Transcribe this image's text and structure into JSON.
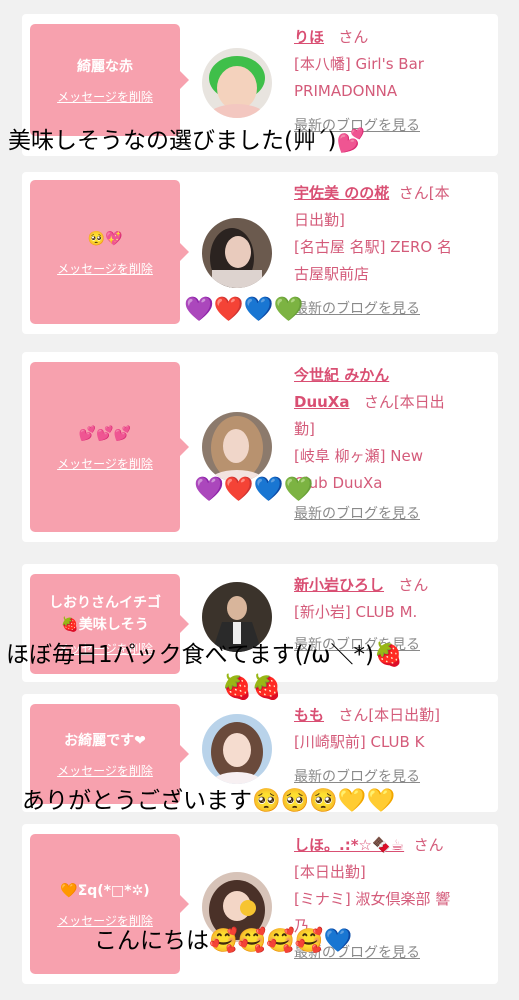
{
  "cards": [
    {
      "message": "綺麗な赤",
      "delete_label": "メッセージを削除",
      "name": "りほ",
      "honorific": "さん",
      "shop_lines": [
        "[本八幡] Girl's Bar",
        "PRIMADONNA"
      ],
      "blog_label": "最新のブログを見る"
    },
    {
      "message": "🥺💖",
      "delete_label": "メッセージを削除",
      "name_lines": [
        "宇佐美 のの椛"
      ],
      "honorific": "さん[本",
      "shop_lines": [
        "日出勤]",
        "[名古屋 名駅] ZERO 名",
        "古屋駅前店"
      ],
      "blog_label": "最新のブログを見る"
    },
    {
      "message": "💕💕💕",
      "delete_label": "メッセージを削除",
      "name_lines": [
        "今世紀 みかん",
        "DuuXa"
      ],
      "honorific": "さん[本日出",
      "shop_lines": [
        "勤]",
        "[岐阜 柳ヶ瀬] New",
        "Club DuuXa"
      ],
      "blog_label": "最新のブログを見る"
    },
    {
      "message_lines": [
        "しおりさんイチゴ",
        "🍓美味しそう"
      ],
      "delete_label": "メッセージを削除",
      "name": "新小岩ひろし",
      "honorific": "さん",
      "shop_lines": [
        "[新小岩] CLUB M."
      ],
      "blog_label": "最新のブログを見る"
    },
    {
      "message": "お綺麗です❤",
      "delete_label": "メッセージを削除",
      "name": "もも",
      "honorific": "さん[本日出勤]",
      "shop_lines": [
        "[川崎駅前] CLUB K"
      ],
      "blog_label": "最新のブログを見る"
    },
    {
      "message": "🧡Σq(*□*✲)",
      "delete_label": "メッセージを削除",
      "name": "しほ。.:*☆🍫☕",
      "honorific": "さん",
      "shop_lines": [
        "[本日出勤]",
        "[ミナミ] 淑女倶楽部 響",
        "乃"
      ],
      "blog_label": "最新のブログを見る"
    }
  ],
  "overlays": {
    "text1": "美味しそうなの選びました(艸´)💕",
    "hearts1": "💜❤️💙💚",
    "hearts2": "💜❤️💙💚",
    "text2": "ほぼ毎日1パック食べてます(/ω＼*)🍓",
    "strawberries": "🍓🍓",
    "text3": "ありがとうございます🥺🥺🥺💛💛",
    "text4": "こんにちは🥰🥰🥰🥰💙"
  },
  "colors": {
    "bubble": "#f7a1ae",
    "accent_text": "#d45b7a",
    "blog_link": "#8a8a8a",
    "background": "#f1f1f1"
  }
}
